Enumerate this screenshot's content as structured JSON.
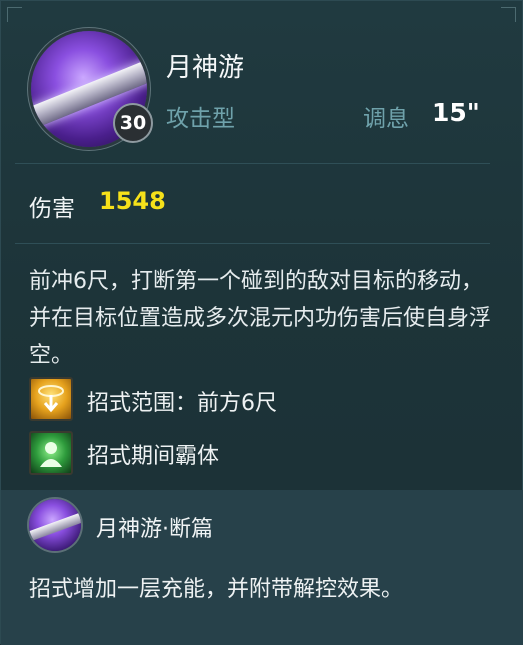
{
  "skill": {
    "name": "月神游",
    "level": "30",
    "type": "攻击型",
    "cooldown_label": "调息",
    "cooldown_value": "15\"",
    "icon": "moon-blade-skill-icon"
  },
  "damage": {
    "label": "伤害",
    "value": "1548"
  },
  "description": "前冲6尺，打断第一个碰到的敌对目标的移动，并在目标位置造成多次混元内功伤害后使自身浮空。",
  "features": [
    {
      "icon": "range-icon",
      "text": "招式范围：前方6尺"
    },
    {
      "icon": "super-armor-icon",
      "text": "招式期间霸体"
    }
  ],
  "extension": {
    "name": "月神游·断篇",
    "icon": "moon-blade-skill-icon",
    "description": "招式增加一层充能，并附带解控效果。"
  },
  "colors": {
    "background": "#1f3238",
    "accent_text": "#6fa2ab",
    "damage_value": "#f6e11a",
    "extension_bg": "#27414a"
  }
}
